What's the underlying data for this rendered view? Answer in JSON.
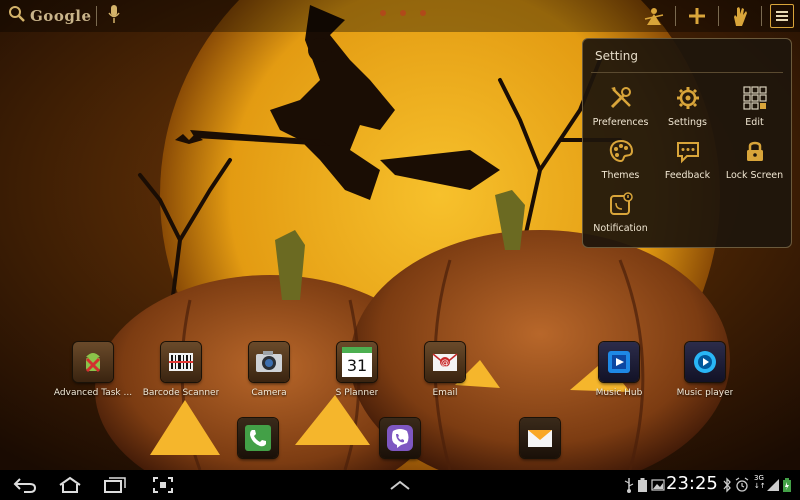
{
  "topbar": {
    "search_logo": "Google",
    "icons": [
      "search-icon",
      "microphone-icon",
      "wand-icon",
      "plus-icon",
      "hand-icon",
      "menu-icon"
    ]
  },
  "setting_panel": {
    "title": "Setting",
    "items": [
      {
        "label": "Preferences",
        "icon": "tools-icon"
      },
      {
        "label": "Settings",
        "icon": "gear-icon"
      },
      {
        "label": "Edit",
        "icon": "grid-icon"
      },
      {
        "label": "Themes",
        "icon": "palette-icon"
      },
      {
        "label": "Feedback",
        "icon": "speech-bubble-icon"
      },
      {
        "label": "Lock Screen",
        "icon": "lock-icon"
      },
      {
        "label": "Notification",
        "icon": "notification-icon"
      }
    ]
  },
  "apps": [
    {
      "label": "Advanced Task ...",
      "icon": "android-task-icon"
    },
    {
      "label": "Barcode Scanner",
      "icon": "barcode-icon"
    },
    {
      "label": "Camera",
      "icon": "camera-icon"
    },
    {
      "label": "S Planner",
      "icon": "calendar-icon",
      "badge": "31"
    },
    {
      "label": "Email",
      "icon": "email-icon"
    },
    {
      "label": "Music Hub",
      "icon": "music-hub-icon"
    },
    {
      "label": "Music player",
      "icon": "music-player-icon"
    }
  ],
  "dock": [
    "phone-icon",
    "viber-icon",
    "messages-icon"
  ],
  "statusbar": {
    "time": "23:25",
    "network": "3G",
    "network_sub": "↓↑"
  },
  "colors": {
    "accent": "#d9a53a",
    "panel_bg": "#1e160c",
    "moon": "#f2b61e"
  }
}
